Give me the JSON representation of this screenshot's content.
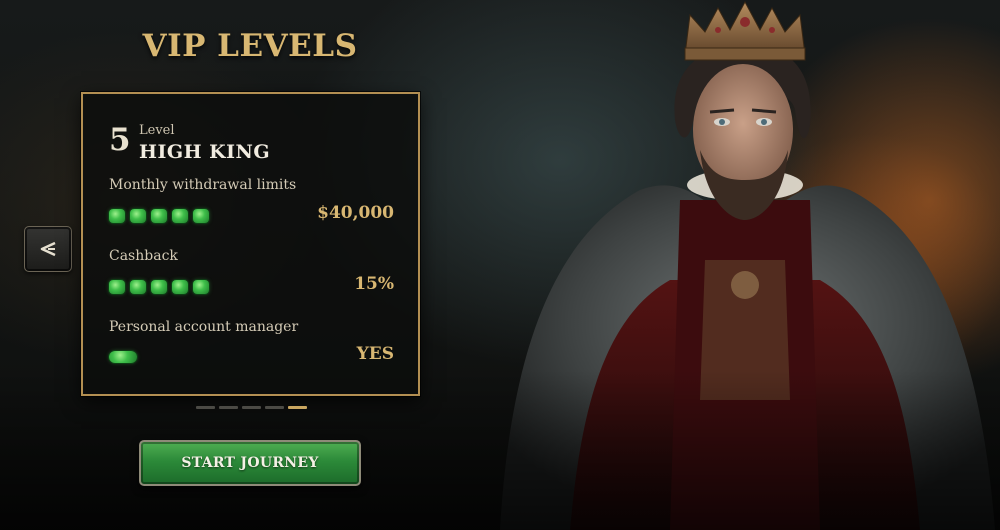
{
  "header": {
    "title": "VIP LEVELS"
  },
  "nav": {
    "back_icon": "chevron-left-icon"
  },
  "card": {
    "level_number": "5",
    "level_label": "Level",
    "level_name": "HIGH KING",
    "rows": [
      {
        "label": "Monthly withdrawal limits",
        "value": "$40,000",
        "gems": 5
      },
      {
        "label": "Cashback",
        "value": "15%",
        "gems": 5
      },
      {
        "label": "Personal account manager",
        "value": "YES",
        "gems": 1
      }
    ]
  },
  "pager": {
    "total": 5,
    "active": 5
  },
  "cta": {
    "label": "START JOURNEY"
  },
  "colors": {
    "gold": "#d8b772",
    "card_border": "#b38f52",
    "gem_green": "#3fbf4a",
    "cta_green": "#2c8a39"
  }
}
